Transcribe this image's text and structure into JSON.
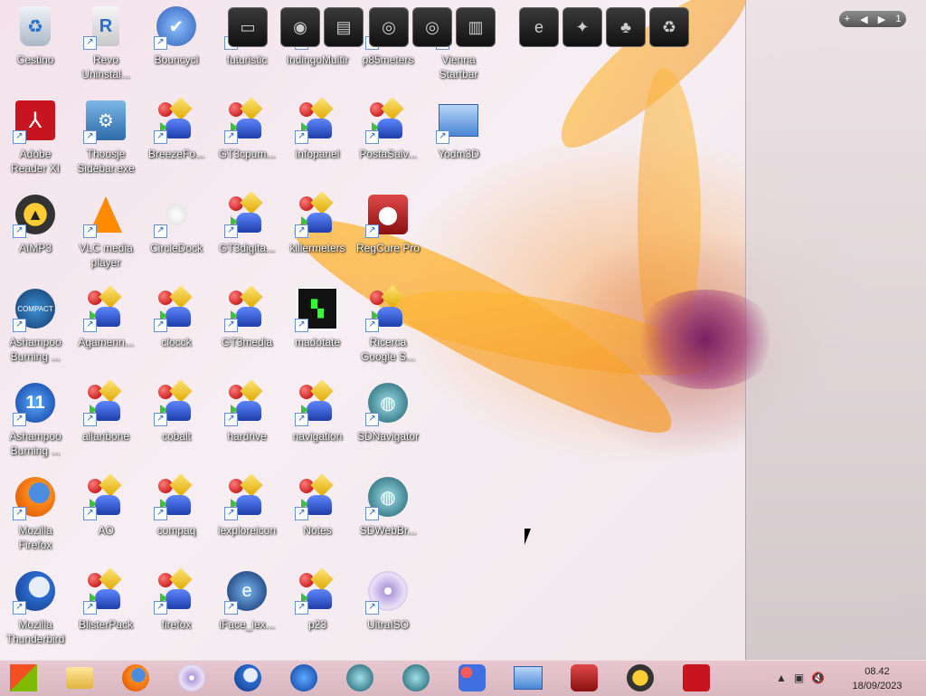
{
  "desktop": {
    "icons": [
      {
        "label": "Cestino",
        "icon": "recycle-bin-icon"
      },
      {
        "label": "Revo Uninstal...",
        "icon": "revo-uninstaller-icon"
      },
      {
        "label": "Bouncycl",
        "icon": "bouncy-icon"
      },
      {
        "label": "futuristic",
        "icon": "app-icon"
      },
      {
        "label": "IndingoMultir",
        "icon": "app-icon"
      },
      {
        "label": "p85meters",
        "icon": "app-icon"
      },
      {
        "label": "Vienna Startbar",
        "icon": "app-icon"
      },
      {
        "label": "Adobe Reader XI",
        "icon": "adobe-reader-icon"
      },
      {
        "label": "Thoosje Sidebar.exe",
        "icon": "sidebar-icon"
      },
      {
        "label": "BreezeFo...",
        "icon": "generic-app-icon"
      },
      {
        "label": "GT3cpum...",
        "icon": "generic-app-icon"
      },
      {
        "label": "infopanel",
        "icon": "generic-app-icon"
      },
      {
        "label": "PostaSalv...",
        "icon": "generic-app-icon"
      },
      {
        "label": "Yodm3D",
        "icon": "yodm3d-icon"
      },
      {
        "label": "AIMP3",
        "icon": "aimp-icon"
      },
      {
        "label": "VLC media player",
        "icon": "vlc-icon"
      },
      {
        "label": "CircleDock",
        "icon": "circledock-icon"
      },
      {
        "label": "GT3digita...",
        "icon": "generic-app-icon"
      },
      {
        "label": "killermeters",
        "icon": "generic-app-icon"
      },
      {
        "label": "RegCure Pro",
        "icon": "regcure-icon"
      },
      {
        "label": "Ashampoo Burning ...",
        "icon": "ashampoo-compact-icon"
      },
      {
        "label": "Agamenn...",
        "icon": "generic-app-icon"
      },
      {
        "label": "clocck",
        "icon": "generic-app-icon"
      },
      {
        "label": "GT3media",
        "icon": "generic-app-icon"
      },
      {
        "label": "madotate",
        "icon": "madotate-icon"
      },
      {
        "label": "Ricerca Google S...",
        "icon": "generic-app-icon"
      },
      {
        "label": "Ashampoo Burning ...",
        "icon": "ashampoo-11-icon"
      },
      {
        "label": "allanbone",
        "icon": "generic-app-icon"
      },
      {
        "label": "cobalt",
        "icon": "generic-app-icon"
      },
      {
        "label": "hardrive",
        "icon": "generic-app-icon"
      },
      {
        "label": "navigation",
        "icon": "generic-app-icon"
      },
      {
        "label": "SDNavigator",
        "icon": "sdnavigator-icon"
      },
      {
        "label": "Mozilla Firefox",
        "icon": "firefox-icon"
      },
      {
        "label": "AO",
        "icon": "generic-app-icon"
      },
      {
        "label": "compaq",
        "icon": "generic-app-icon"
      },
      {
        "label": "iexploreicon",
        "icon": "generic-app-icon"
      },
      {
        "label": "Notes",
        "icon": "generic-app-icon"
      },
      {
        "label": "SDWebBr...",
        "icon": "sdwebbrowser-icon"
      },
      {
        "label": "Mozilla Thunderbird",
        "icon": "thunderbird-icon"
      },
      {
        "label": "BlisterPack",
        "icon": "generic-app-icon"
      },
      {
        "label": "firefox",
        "icon": "generic-app-icon"
      },
      {
        "label": "iFace_iex...",
        "icon": "iface-icon"
      },
      {
        "label": "p23",
        "icon": "generic-app-icon"
      },
      {
        "label": "UltraISO",
        "icon": "ultraiso-icon"
      }
    ]
  },
  "dock": {
    "items": [
      "monitor-icon",
      "globe-icon",
      "folder-icon",
      "webcam-icon",
      "speaker-icon",
      "mixer-icon",
      "ie-icon",
      "tshirt-icon",
      "users-icon",
      "recycle-icon"
    ],
    "bar": {
      "add": "+",
      "prev": "◀",
      "next": "▶",
      "page": "1"
    }
  },
  "taskbar": {
    "buttons": [
      "windows-start-icon",
      "explorer-icon",
      "firefox-icon",
      "ultraiso-icon",
      "thunderbird-icon",
      "ashampoo-11-icon",
      "sdnavigator-icon",
      "sdwebbrowser-icon",
      "generic-app-icon",
      "yodm3d-icon",
      "regcure-icon",
      "aimp-icon",
      "adobe-reader-icon"
    ],
    "tray": {
      "chevron": "▲",
      "network": "▣",
      "volume": "🔇"
    },
    "clock": {
      "time": "08.42",
      "date": "18/09/2023"
    }
  }
}
